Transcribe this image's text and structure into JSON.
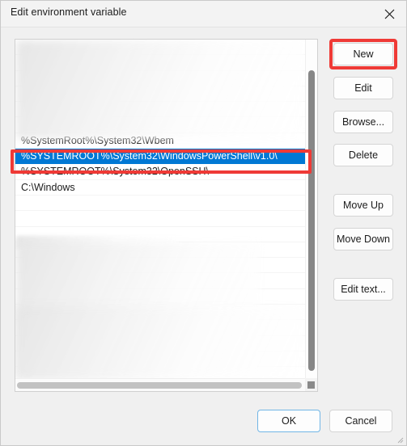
{
  "window": {
    "title": "Edit environment variable",
    "close_icon": "close-icon"
  },
  "list": {
    "rows": [
      {
        "text": "",
        "state": "blurred"
      },
      {
        "text": "",
        "state": "blurred"
      },
      {
        "text": "",
        "state": "blurred"
      },
      {
        "text": "",
        "state": "blurred"
      },
      {
        "text": "",
        "state": "blurred"
      },
      {
        "text": "",
        "state": "blurred"
      },
      {
        "text": "%SystemRoot%\\System32\\Wbem",
        "state": "normal"
      },
      {
        "text": "%SYSTEMROOT%\\System32\\WindowsPowerShell\\v1.0\\",
        "state": "selected"
      },
      {
        "text": "%SYSTEMROOT%\\System32\\OpenSSH\\",
        "state": "normal"
      },
      {
        "text": "C:\\Windows",
        "state": "normal"
      },
      {
        "text": "",
        "state": "blurred"
      },
      {
        "text": "",
        "state": "blurred"
      },
      {
        "text": "",
        "state": "blurred"
      },
      {
        "text": "",
        "state": "blurred"
      },
      {
        "text": "",
        "state": "empty"
      },
      {
        "text": "",
        "state": "empty"
      },
      {
        "text": "",
        "state": "empty"
      },
      {
        "text": "",
        "state": "empty"
      },
      {
        "text": "",
        "state": "empty"
      },
      {
        "text": "",
        "state": "empty"
      },
      {
        "text": "",
        "state": "empty"
      },
      {
        "text": "",
        "state": "empty"
      }
    ],
    "selected_index": 7,
    "selected_value": "%SYSTEMROOT%\\System32\\WindowsPowerShell\\v1.0\\"
  },
  "side_buttons": {
    "new": "New",
    "edit": "Edit",
    "browse": "Browse...",
    "delete": "Delete",
    "move_up": "Move Up",
    "move_down": "Move Down",
    "edit_text": "Edit text..."
  },
  "footer_buttons": {
    "ok": "OK",
    "cancel": "Cancel"
  },
  "annotations": {
    "color": "#ef3a36",
    "targets": [
      "new-button",
      "selected-list-row"
    ]
  },
  "colors": {
    "accent": "#0078d4",
    "dialog_background": "#f0f0f0",
    "titlebar_background": "#f3f3f3",
    "list_background": "#ffffff",
    "annotation_red": "#ef3a36",
    "default_button_border": "#71b6e6"
  }
}
